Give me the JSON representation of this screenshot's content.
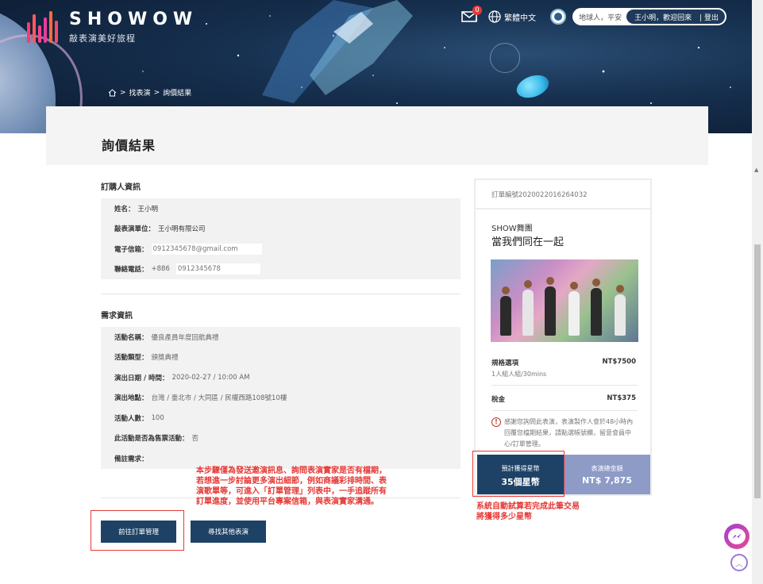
{
  "brand": {
    "name": "SHOWOW",
    "tagline": "敲表演美好旅程",
    "bar_colors": [
      "#ff3b6b",
      "#ff5a5f",
      "#f7428e",
      "#e83d9c",
      "#ff6a3d",
      "#f24b6b"
    ]
  },
  "top_nav": {
    "mail_badge": "0",
    "language": "繁體中文",
    "greeting": "地球人，平安",
    "welcome": "王小明，歡迎回來",
    "logout": "| 登出"
  },
  "breadcrumb": {
    "items": [
      "找表演",
      "詢價結果"
    ],
    "separator": ">"
  },
  "page_title": "詢價結果",
  "buyer_info": {
    "title": "訂購人資訊",
    "rows": [
      {
        "label": "姓名：",
        "value": "王小明"
      },
      {
        "label": "敲表演單位：",
        "value": "王小明有限公司"
      },
      {
        "label": "電子信箱：",
        "value": "0912345678@gmail.com"
      },
      {
        "label": "聯絡電話：",
        "prefix": "+886",
        "value": "0912345678"
      }
    ]
  },
  "demand_info": {
    "title": "需求資訊",
    "rows": [
      {
        "label": "活動名稱：",
        "value": "優良產員年度回航典禮"
      },
      {
        "label": "活動類型：",
        "value": "頒獎典禮"
      },
      {
        "label": "演出日期 / 時間：",
        "value": "2020-02-27 / 10:00 AM"
      },
      {
        "label": "演出地點：",
        "value": "台灣 / 臺北市 / 大同區 / 民權西路108號10樓"
      },
      {
        "label": "活動人數：",
        "value": "100"
      },
      {
        "label": "此活動是否為售票活動：",
        "value": "否"
      },
      {
        "label": "備註需求：",
        "value": ""
      }
    ]
  },
  "order_card": {
    "order_no": "訂單編號2020022016264032",
    "troupe": "SHOW舞團",
    "show_name": "當我們同在一起",
    "spec_label": "規格選項",
    "spec_price": "NT$7500",
    "spec_sub": "1人組人組/30mins",
    "tax_label": "稅金",
    "tax_value": "NT$375",
    "notice": "感謝您詢問此表演，表演製作人會於48小時內回覆您檔期結果，請點選帳號欄，留意會員中心/訂單管理。",
    "stars_label": "預計獲得星幣",
    "stars_value": "35個星幣",
    "total_label": "表演總金額",
    "total_value": "NT$ 7,875"
  },
  "buttons": {
    "orders": "前往訂單管理",
    "find_more": "尋找其他表演"
  },
  "annotations": {
    "step_note": [
      "本步驟僅為發送邀演訊息、詢問表演實家是否有檔期，",
      "若想進一步討論更多演出細節，例如商議彩排時間、表",
      "演歌單等，可進入「訂單管理」列表中，一手追蹤所有",
      "訂單進度，並使用平台專案信箱，與表演實家溝通。"
    ],
    "stars_note": [
      "系統自動試算若完成此筆交易",
      "將獲得多少星幣"
    ],
    "color": "#e53935"
  },
  "colors": {
    "primary": "#1e4266",
    "secondary": "#8e9bc7"
  }
}
